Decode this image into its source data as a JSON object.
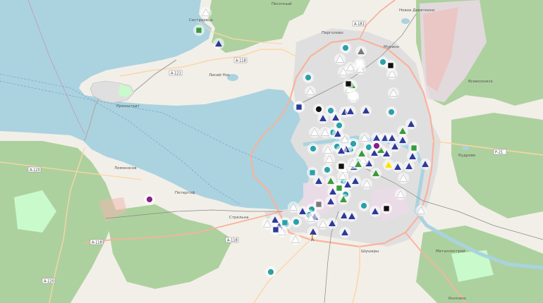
{
  "map": {
    "colors": {
      "water": "#aad3df",
      "land": "#f2efe9",
      "forest": "#add19e",
      "park": "#c8facc",
      "urban": "#e0dfdf",
      "industrial": "#ebdbe8",
      "major_road": "#f9b29c",
      "primary_road": "#fcd6a4",
      "boundary": "#9e9cab",
      "marker_teal": "#2aa1a9",
      "marker_navy": "#2e3a99",
      "marker_green": "#3a9a3a",
      "marker_gray": "#7a7a7a",
      "marker_black": "#111111",
      "marker_purple": "#8a1f8a",
      "marker_yellow": "#ffe000"
    },
    "place_labels": {
      "sestroretsk": "Сестрорецк",
      "lisy_nos": "Лисий Нос",
      "kronshtadt": "Кронштадт",
      "lomonosov": "Ломоносов",
      "strelna": "Стрельна",
      "peterhof": "Петергоф",
      "shushary": "Шушары",
      "kolpino": "Колпино",
      "vsevolozhsk": "Всеволожск",
      "kudrovo": "Кудрово",
      "pargolovo": "Парголово",
      "murino": "Мурино",
      "novoe_devyatkino": "Новое Девяткино",
      "metallostroy": "Металлострой",
      "pesochny": "Песочный"
    },
    "road_shields": [
      "А-118",
      "А-181",
      "А-121",
      "А-120",
      "Р-21",
      "А-118",
      "А-118",
      "А-120"
    ],
    "marker_counts": {
      "teal_circle": 22,
      "navy_triangle": 40,
      "white_triangle": 30,
      "green_triangle": 8,
      "square": 14,
      "other": 6
    }
  }
}
